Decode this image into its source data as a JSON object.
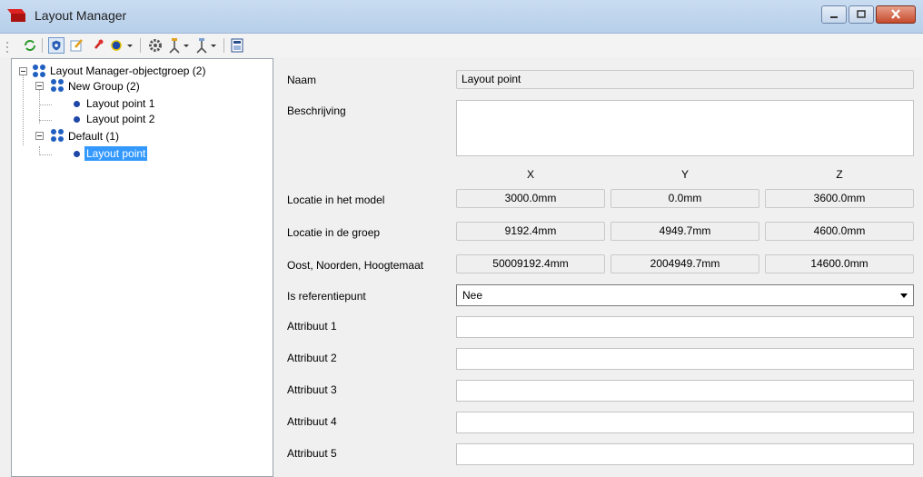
{
  "window": {
    "title": "Layout Manager",
    "controls": [
      "minimize-icon",
      "maximize-icon",
      "close-icon"
    ]
  },
  "toolbar": {
    "buttons": [
      "refresh-icon",
      "shield-icon",
      "edit-icon",
      "pin-icon",
      "dot-dropdown-icon",
      "settings-icon",
      "survey-icon",
      "survey-icon",
      "calculator-icon"
    ]
  },
  "tree": {
    "root": "Layout Manager-objectgroep (2)",
    "groups": [
      {
        "label": "New Group (2)",
        "items": [
          "Layout point 1",
          "Layout point 2"
        ]
      },
      {
        "label": "Default (1)",
        "items": [
          "Layout point"
        ]
      }
    ],
    "selected": "Layout point"
  },
  "props": {
    "naam_label": "Naam",
    "naam_value": "Layout point",
    "beschrijving_label": "Beschrijving",
    "beschrijving_value": "",
    "col_x": "X",
    "col_y": "Y",
    "col_z": "Z",
    "rows": [
      {
        "label": "Locatie in het model",
        "x": "3000.0mm",
        "y": "0.0mm",
        "z": "3600.0mm"
      },
      {
        "label": "Locatie in de groep",
        "x": "9192.4mm",
        "y": "4949.7mm",
        "z": "4600.0mm"
      },
      {
        "label": "Oost, Noorden, Hoogtemaat",
        "x": "50009192.4mm",
        "y": "2004949.7mm",
        "z": "14600.0mm"
      }
    ],
    "referentie_label": "Is referentiepunt",
    "referentie_value": "Nee",
    "attributes": [
      {
        "label": "Attribuut 1",
        "value": ""
      },
      {
        "label": "Attribuut 2",
        "value": ""
      },
      {
        "label": "Attribuut 3",
        "value": ""
      },
      {
        "label": "Attribuut 4",
        "value": ""
      },
      {
        "label": "Attribuut 5",
        "value": ""
      }
    ]
  },
  "colors": {
    "selection": "#3399ff",
    "point": "#1f47a8",
    "group": "#2060c0"
  }
}
